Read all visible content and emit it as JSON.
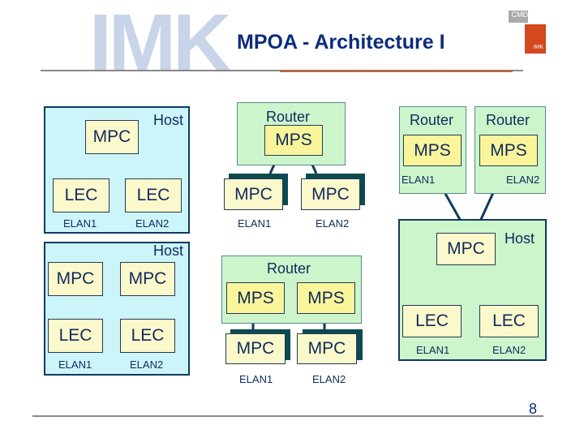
{
  "header": {
    "watermark": "IMK",
    "title": "MPOA - Architecture I",
    "logo_top": "CMD",
    "logo_bottom": "IMK"
  },
  "diagram": {
    "panel1": {
      "label": "Host",
      "mpc": "MPC",
      "lec1": "LEC",
      "lec2": "LEC",
      "elan1": "ELAN1",
      "elan2": "ELAN2"
    },
    "panel2": {
      "label": "Router",
      "mps": "MPS",
      "mpc1": "MPC",
      "mpc2": "MPC",
      "elan1": "ELAN1",
      "elan2": "ELAN2"
    },
    "panel3": {
      "router1": "Router",
      "router2": "Router",
      "mps1": "MPS",
      "mps2": "MPS",
      "elan1": "ELAN1",
      "elan2": "ELAN2",
      "host_label": "Host",
      "mpc": "MPC",
      "lec1": "LEC",
      "lec2": "LEC",
      "host_elan1": "ELAN1",
      "host_elan2": "ELAN2"
    },
    "panel4": {
      "label": "Host",
      "mpc1": "MPC",
      "mpc2": "MPC",
      "lec1": "LEC",
      "lec2": "LEC",
      "elan1": "ELAN1",
      "elan2": "ELAN2"
    },
    "panel5": {
      "label": "Router",
      "mps1": "MPS",
      "mps2": "MPS",
      "mpc1": "MPC",
      "mpc2": "MPC",
      "elan1": "ELAN1",
      "elan2": "ELAN2"
    }
  },
  "footer": {
    "page_number": "8"
  }
}
